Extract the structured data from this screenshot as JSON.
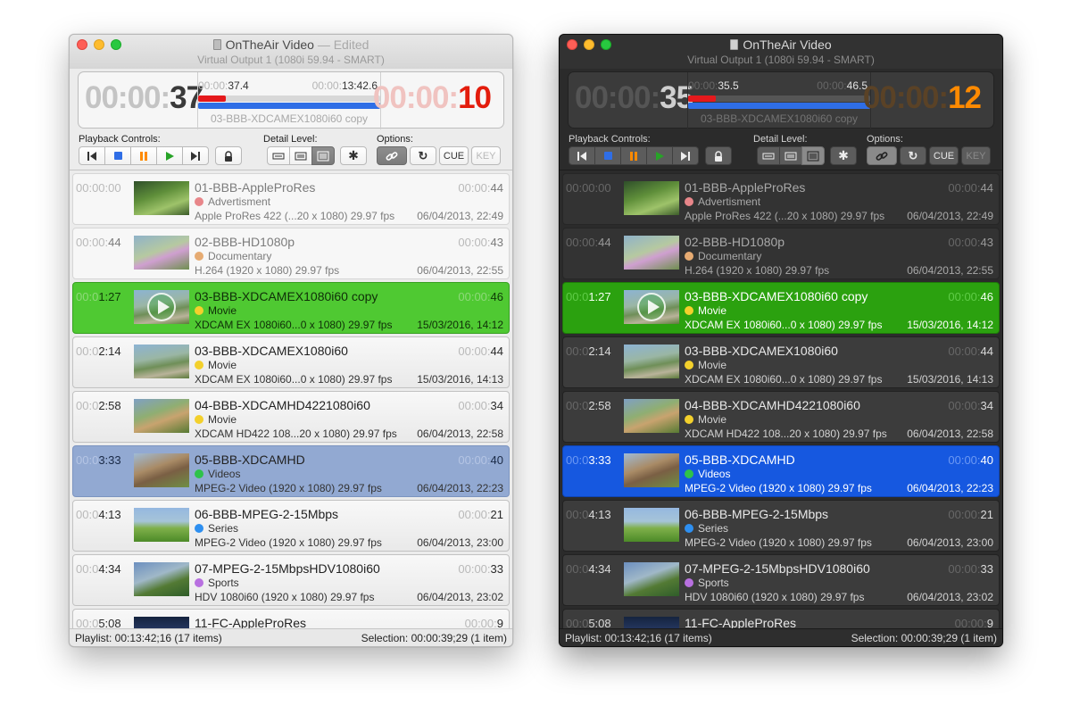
{
  "palette": {
    "light_bg": "#ececec",
    "dark_bg": "#2b2b2b",
    "playing_light": "#4fc932",
    "playing_dark": "#2ba10f",
    "selected_light": "#92a9d2",
    "selected_dark": "#1658e0",
    "remaining_light": "#e31c0c",
    "remaining_dark": "#ff8a00",
    "progress_red": "#e5191c",
    "progress_blue": "#2f6ee6"
  },
  "category_colors": {
    "Advertisment": "#e8868a",
    "Documentary": "#e6ab72",
    "Movie": "#f3d02c",
    "Videos": "#2fc24a",
    "Series": "#2e8ff0",
    "Sports": "#b870e0"
  },
  "light": {
    "title": "OnTheAir Video",
    "edited": "— Edited",
    "subtitle": "Virtual Output 1 (1080i 59.94 - SMART)",
    "elapsed_dim": "00:00:",
    "elapsed_hi": "37",
    "pos_dim": "00:00:",
    "pos_hi": "37.4",
    "dur_dim": "00:00:",
    "dur_hi": "13:42.6",
    "remaining_dim": "00:00:",
    "remaining_hi": "10",
    "red_progress_fraction": 0.15,
    "blue_progress_fraction": 1.0,
    "current_clip": "03-BBB-XDCAMEX1080i60 copy",
    "playback_label": "Playback Controls:",
    "detail_label": "Detail Level:",
    "options_label": "Options:",
    "cue_label": "CUE",
    "key_label": "KEY",
    "status_left": "Playlist: 00:13:42;16 (17 items)",
    "status_right": "Selection: 00:00:39;29 (1 item)",
    "rows": [
      {
        "state": "played",
        "start_dim": "00:00:00",
        "start_hi": "",
        "name": "01-BBB-AppleProRes",
        "category": "Advertisment",
        "info": "Apple ProRes 422 (...20 x 1080) 29.97 fps",
        "dur_dim": "00:00:",
        "dur_hi": "44",
        "date": "06/04/2013, 22:49",
        "thumb": "forest"
      },
      {
        "state": "played",
        "start_dim": "00:00:",
        "start_hi": "44",
        "name": "02-BBB-HD1080p",
        "category": "Documentary",
        "info": "H.264 (1920 x 1080) 29.97 fps",
        "dur_dim": "00:00:",
        "dur_hi": "43",
        "date": "06/04/2013, 22:55",
        "thumb": "butterfly"
      },
      {
        "state": "playing",
        "start_dim": "00:0",
        "start_hi": "1:27",
        "name": "03-BBB-XDCAMEX1080i60 copy",
        "category": "Movie",
        "info": "XDCAM EX 1080i60...0 x 1080) 29.97 fps",
        "dur_dim": "00:00:",
        "dur_hi": "46",
        "date": "15/03/2016, 14:12",
        "thumb": "bunny"
      },
      {
        "state": "normal",
        "start_dim": "00:0",
        "start_hi": "2:14",
        "name": "03-BBB-XDCAMEX1080i60",
        "category": "Movie",
        "info": "XDCAM EX 1080i60...0 x 1080) 29.97 fps",
        "dur_dim": "00:00:",
        "dur_hi": "44",
        "date": "15/03/2016, 14:13",
        "thumb": "bunny"
      },
      {
        "state": "normal",
        "start_dim": "00:0",
        "start_hi": "2:58",
        "name": "04-BBB-XDCAMHD4221080i60",
        "category": "Movie",
        "info": "XDCAM HD422 108...20 x 1080) 29.97 fps",
        "dur_dim": "00:00:",
        "dur_hi": "34",
        "date": "06/04/2013, 22:58",
        "thumb": "critters"
      },
      {
        "state": "selected",
        "start_dim": "00:0",
        "start_hi": "3:33",
        "name": "05-BBB-XDCAMHD",
        "category": "Videos",
        "info": "MPEG-2 Video (1920 x 1080) 29.97 fps",
        "dur_dim": "00:00:",
        "dur_hi": "40",
        "date": "06/04/2013, 22:23",
        "thumb": "squirrel"
      },
      {
        "state": "normal",
        "start_dim": "00:0",
        "start_hi": "4:13",
        "name": "06-BBB-MPEG-2-15Mbps",
        "category": "Series",
        "info": "MPEG-2 Video (1920 x 1080) 29.97 fps",
        "dur_dim": "00:00:",
        "dur_hi": "21",
        "date": "06/04/2013, 23:00",
        "thumb": "meadow"
      },
      {
        "state": "normal",
        "start_dim": "00:0",
        "start_hi": "4:34",
        "name": "07-MPEG-2-15MbpsHDV1080i60",
        "category": "Sports",
        "info": "HDV 1080i60 (1920 x 1080) 29.97 fps",
        "dur_dim": "00:00:",
        "dur_hi": "33",
        "date": "06/04/2013, 23:02",
        "thumb": "tree"
      },
      {
        "state": "normal",
        "start_dim": "00:0",
        "start_hi": "5:08",
        "name": "11-FC-AppleProRes",
        "category": "",
        "info": "",
        "dur_dim": "00:00:",
        "dur_hi": "9",
        "date": "",
        "thumb": "dark"
      }
    ]
  },
  "dark": {
    "title": "OnTheAir Video",
    "subtitle": "Virtual Output 1 (1080i 59.94 - SMART)",
    "elapsed_dim": "00:00:",
    "elapsed_hi": "35",
    "pos_dim": "00:00:",
    "pos_hi": "35.5",
    "dur_dim": "00:00:",
    "dur_hi": "46.5",
    "remaining_dim": "00:00:",
    "remaining_hi": "12",
    "red_progress_fraction": 0.15,
    "blue_progress_fraction": 1.0,
    "current_clip": "03-BBB-XDCAMEX1080i60 copy",
    "playback_label": "Playback Controls:",
    "detail_label": "Detail Level:",
    "options_label": "Options:",
    "cue_label": "CUE",
    "key_label": "KEY",
    "status_left": "Playlist: 00:13:42;16 (17 items)",
    "status_right": "Selection: 00:00:39;29 (1 item)",
    "rows": [
      {
        "state": "played",
        "start_dim": "00:00:00",
        "start_hi": "",
        "name": "01-BBB-AppleProRes",
        "category": "Advertisment",
        "info": "Apple ProRes 422 (...20 x 1080) 29.97 fps",
        "dur_dim": "00:00:",
        "dur_hi": "44",
        "date": "06/04/2013, 22:49",
        "thumb": "forest"
      },
      {
        "state": "played",
        "start_dim": "00:00:",
        "start_hi": "44",
        "name": "02-BBB-HD1080p",
        "category": "Documentary",
        "info": "H.264 (1920 x 1080) 29.97 fps",
        "dur_dim": "00:00:",
        "dur_hi": "43",
        "date": "06/04/2013, 22:55",
        "thumb": "butterfly"
      },
      {
        "state": "playing",
        "start_dim": "00:0",
        "start_hi": "1:27",
        "name": "03-BBB-XDCAMEX1080i60 copy",
        "category": "Movie",
        "info": "XDCAM EX 1080i60...0 x 1080) 29.97 fps",
        "dur_dim": "00:00:",
        "dur_hi": "46",
        "date": "15/03/2016, 14:12",
        "thumb": "bunny"
      },
      {
        "state": "normal",
        "start_dim": "00:0",
        "start_hi": "2:14",
        "name": "03-BBB-XDCAMEX1080i60",
        "category": "Movie",
        "info": "XDCAM EX 1080i60...0 x 1080) 29.97 fps",
        "dur_dim": "00:00:",
        "dur_hi": "44",
        "date": "15/03/2016, 14:13",
        "thumb": "bunny"
      },
      {
        "state": "normal",
        "start_dim": "00:0",
        "start_hi": "2:58",
        "name": "04-BBB-XDCAMHD4221080i60",
        "category": "Movie",
        "info": "XDCAM HD422 108...20 x 1080) 29.97 fps",
        "dur_dim": "00:00:",
        "dur_hi": "34",
        "date": "06/04/2013, 22:58",
        "thumb": "critters"
      },
      {
        "state": "selected",
        "start_dim": "00:0",
        "start_hi": "3:33",
        "name": "05-BBB-XDCAMHD",
        "category": "Videos",
        "info": "MPEG-2 Video (1920 x 1080) 29.97 fps",
        "dur_dim": "00:00:",
        "dur_hi": "40",
        "date": "06/04/2013, 22:23",
        "thumb": "squirrel"
      },
      {
        "state": "normal",
        "start_dim": "00:0",
        "start_hi": "4:13",
        "name": "06-BBB-MPEG-2-15Mbps",
        "category": "Series",
        "info": "MPEG-2 Video (1920 x 1080) 29.97 fps",
        "dur_dim": "00:00:",
        "dur_hi": "21",
        "date": "06/04/2013, 23:00",
        "thumb": "meadow"
      },
      {
        "state": "normal",
        "start_dim": "00:0",
        "start_hi": "4:34",
        "name": "07-MPEG-2-15MbpsHDV1080i60",
        "category": "Sports",
        "info": "HDV 1080i60 (1920 x 1080) 29.97 fps",
        "dur_dim": "00:00:",
        "dur_hi": "33",
        "date": "06/04/2013, 23:02",
        "thumb": "tree"
      },
      {
        "state": "normal",
        "start_dim": "00:0",
        "start_hi": "5:08",
        "name": "11-FC-AppleProRes",
        "category": "",
        "info": "",
        "dur_dim": "00:00:",
        "dur_hi": "9",
        "date": "",
        "thumb": "dark"
      }
    ]
  }
}
